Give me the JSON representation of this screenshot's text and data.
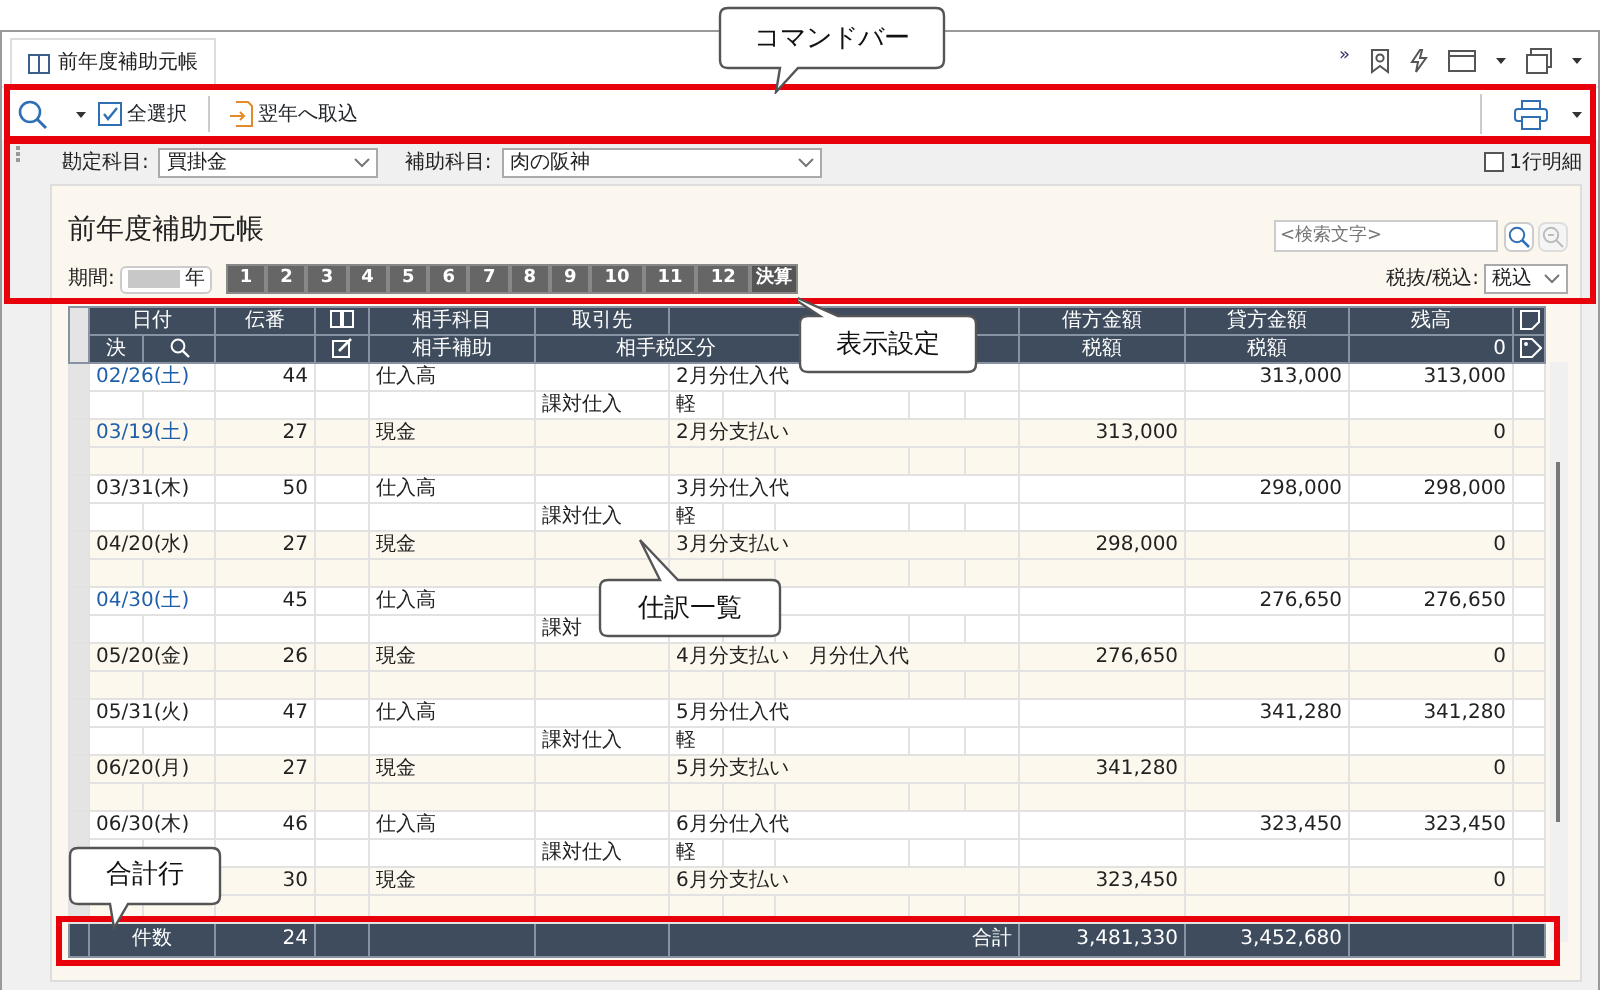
{
  "window_tab": {
    "title": "前年度補助元帳"
  },
  "toolbar_overflow": "»",
  "command_bar": {
    "select_all": "全選択",
    "import": "翌年へ取込"
  },
  "filters": {
    "account_label": "勘定科目:",
    "account_value": "買掛金",
    "sub_label": "補助科目:",
    "sub_value": "肉の阪神",
    "one_line": {
      "label": "1行明細",
      "checked": false
    }
  },
  "panel": {
    "title": "前年度補助元帳",
    "search_placeholder": "<検索文字>",
    "period_label": "期間:",
    "year_suffix": "年",
    "periods": [
      "1",
      "2",
      "3",
      "4",
      "5",
      "6",
      "7",
      "8",
      "9",
      "10",
      "11",
      "12",
      "決算"
    ],
    "tax_label": "税抜/税込:",
    "tax_value": "税込"
  },
  "table": {
    "header_top": {
      "date": "日付",
      "number": "伝番",
      "account": "相手科目",
      "partner": "取引先",
      "debit": "借方金額",
      "credit": "貸方金額",
      "balance": "残高"
    },
    "header_bottom": {
      "settled": "決",
      "sub_account": "相手補助",
      "tax_class": "相手税区分",
      "debit_tax": "税額",
      "credit_tax": "税額",
      "balance": "0"
    },
    "rows": [
      {
        "date": "02/26(土)",
        "link": true,
        "number": "44",
        "account": "仕入高",
        "description": "2月分仕入代",
        "debit": "",
        "credit": "313,000",
        "balance": "313,000",
        "tax_class": "課対仕入",
        "tax_mark": "軽"
      },
      {
        "date": "03/19(土)",
        "link": true,
        "number": "27",
        "account": "現金",
        "description": "2月分支払い",
        "debit": "313,000",
        "credit": "",
        "balance": "0",
        "tax_class": "",
        "tax_mark": ""
      },
      {
        "date": "03/31(木)",
        "link": false,
        "number": "50",
        "account": "仕入高",
        "description": "3月分仕入代",
        "debit": "",
        "credit": "298,000",
        "balance": "298,000",
        "tax_class": "課対仕入",
        "tax_mark": "軽"
      },
      {
        "date": "04/20(水)",
        "link": false,
        "number": "27",
        "account": "現金",
        "description": "3月分支払い",
        "debit": "298,000",
        "credit": "",
        "balance": "0",
        "tax_class": "",
        "tax_mark": ""
      },
      {
        "date": "04/30(土)",
        "link": true,
        "number": "45",
        "account": "仕入高",
        "description": "",
        "debit": "",
        "credit": "276,650",
        "balance": "276,650",
        "tax_class": "課対",
        "tax_mark": ""
      },
      {
        "date": "05/20(金)",
        "link": false,
        "number": "26",
        "account": "現金",
        "description": "4月分支払い　月分仕入代",
        "debit": "276,650",
        "credit": "",
        "balance": "0",
        "tax_class": "",
        "tax_mark": ""
      },
      {
        "date": "05/31(火)",
        "link": false,
        "number": "47",
        "account": "仕入高",
        "description": "5月分仕入代",
        "debit": "",
        "credit": "341,280",
        "balance": "341,280",
        "tax_class": "課対仕入",
        "tax_mark": "軽"
      },
      {
        "date": "06/20(月)",
        "link": false,
        "number": "27",
        "account": "現金",
        "description": "5月分支払い",
        "debit": "341,280",
        "credit": "",
        "balance": "0",
        "tax_class": "",
        "tax_mark": ""
      },
      {
        "date": "06/30(木)",
        "link": false,
        "number": "46",
        "account": "仕入高",
        "description": "6月分仕入代",
        "debit": "",
        "credit": "323,450",
        "balance": "323,450",
        "tax_class": "課対仕入",
        "tax_mark": "軽"
      },
      {
        "number": "30",
        "account": "現金",
        "description": "6月分支払い",
        "debit": "323,450",
        "credit": "",
        "balance": "0",
        "tax_class": "",
        "tax_mark": ""
      }
    ],
    "totals": {
      "count_label": "件数",
      "count": "24",
      "sum_label": "合計",
      "debit": "3,481,330",
      "credit": "3,452,680"
    }
  },
  "callouts": [
    {
      "text": "コマンドバー"
    },
    {
      "text": "表示設定"
    },
    {
      "text": "仕訳一覧"
    },
    {
      "text": "合計行"
    }
  ]
}
